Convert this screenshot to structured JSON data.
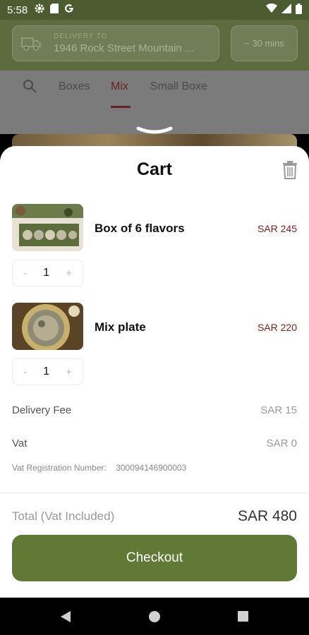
{
  "status_bar": {
    "time": "5:58",
    "icons": [
      "gear-icon",
      "sim-icon",
      "google-icon",
      "wifi-icon",
      "signal-icon",
      "battery-icon"
    ]
  },
  "header": {
    "delivery_label": "DELIVERY TO",
    "delivery_address": "1946 Rock Street Mountain ...",
    "eta": "~ 30 mins"
  },
  "tabs": [
    {
      "label": "Boxes",
      "active": false
    },
    {
      "label": "Mix",
      "active": true
    },
    {
      "label": "Small Boxe",
      "active": false
    }
  ],
  "cart": {
    "title": "Cart",
    "items": [
      {
        "name": "Box of 6 flavors",
        "price": "SAR 245",
        "qty": "1",
        "minus": "-",
        "plus": "+"
      },
      {
        "name": "Mix plate",
        "price": "SAR 220",
        "qty": "1",
        "minus": "-",
        "plus": "+"
      }
    ],
    "delivery_fee_label": "Delivery Fee",
    "delivery_fee_value": "SAR 15",
    "vat_label": "Vat",
    "vat_value": "SAR 0",
    "vat_reg_label": "Vat Registration Number:",
    "vat_reg_number": "300094146900003",
    "total_label": "Total",
    "total_note": "(Vat Included)",
    "total_value": "SAR 480",
    "checkout_label": "Checkout"
  },
  "colors": {
    "brand_green": "#607a35",
    "price_red": "#7a1d1d",
    "active_tab": "#6a1f22"
  }
}
